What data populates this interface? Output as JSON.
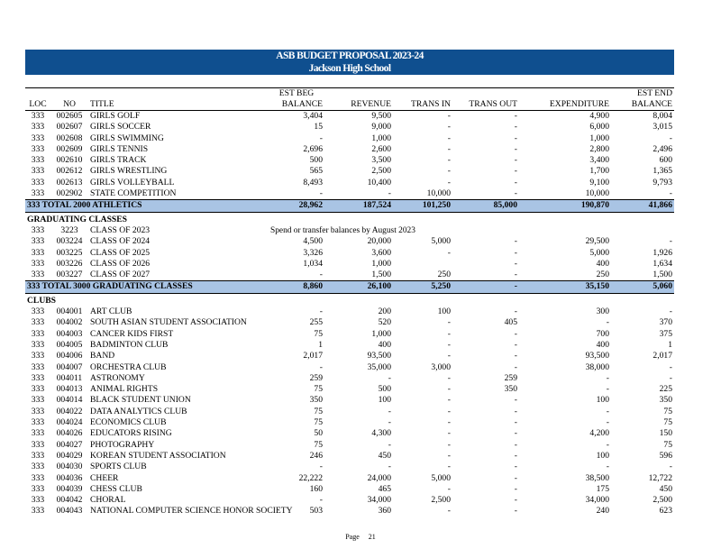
{
  "header": {
    "title": "ASB BUDGET PROPOSAL 2023-24",
    "school": "Jackson High School"
  },
  "columns": {
    "loc": "LOC",
    "no": "NO",
    "title": "TITLE",
    "est_beg_top": "EST BEG",
    "est_beg_bottom": "BALANCE",
    "revenue": "REVENUE",
    "trans_in": "TRANS IN",
    "trans_out": "TRANS OUT",
    "expenditure": "EXPENDITURE",
    "est_end_top": "EST END",
    "est_end_bottom": "BALANCE"
  },
  "athletics_rows": [
    {
      "loc": "333",
      "no": "002605",
      "title": "GIRLS GOLF",
      "beg": "3,404",
      "rev": "9,500",
      "tin": "-",
      "tout": "-",
      "exp": "4,900",
      "end": "8,004"
    },
    {
      "loc": "333",
      "no": "002607",
      "title": "GIRLS SOCCER",
      "beg": "15",
      "rev": "9,000",
      "tin": "-",
      "tout": "-",
      "exp": "6,000",
      "end": "3,015"
    },
    {
      "loc": "333",
      "no": "002608",
      "title": "GIRLS SWIMMING",
      "beg": "-",
      "rev": "1,000",
      "tin": "-",
      "tout": "-",
      "exp": "1,000",
      "end": "-"
    },
    {
      "loc": "333",
      "no": "002609",
      "title": "GIRLS TENNIS",
      "beg": "2,696",
      "rev": "2,600",
      "tin": "-",
      "tout": "-",
      "exp": "2,800",
      "end": "2,496"
    },
    {
      "loc": "333",
      "no": "002610",
      "title": "GIRLS TRACK",
      "beg": "500",
      "rev": "3,500",
      "tin": "-",
      "tout": "-",
      "exp": "3,400",
      "end": "600"
    },
    {
      "loc": "333",
      "no": "002612",
      "title": "GIRLS WRESTLING",
      "beg": "565",
      "rev": "2,500",
      "tin": "-",
      "tout": "-",
      "exp": "1,700",
      "end": "1,365"
    },
    {
      "loc": "333",
      "no": "002613",
      "title": "GIRLS VOLLEYBALL",
      "beg": "8,493",
      "rev": "10,400",
      "tin": "-",
      "tout": "-",
      "exp": "9,100",
      "end": "9,793"
    },
    {
      "loc": "333",
      "no": "002902",
      "title": "STATE COMPETITION",
      "beg": "-",
      "rev": "-",
      "tin": "10,000",
      "tout": "-",
      "exp": "10,000",
      "end": "-"
    }
  ],
  "athletics_total": {
    "label": "333  TOTAL 2000 ATHLETICS",
    "beg": "28,962",
    "rev": "187,524",
    "tin": "101,250",
    "tout": "85,000",
    "exp": "190,870",
    "end": "41,866"
  },
  "graduating": {
    "heading": "GRADUATING CLASSES",
    "note_row": {
      "loc": "333",
      "no": "3223",
      "title": "CLASS OF 2023",
      "note": "Spend or transfer  balances  by August 2023"
    },
    "rows": [
      {
        "loc": "333",
        "no": "003224",
        "title": "CLASS OF 2024",
        "beg": "4,500",
        "rev": "20,000",
        "tin": "5,000",
        "tout": "-",
        "exp": "29,500",
        "end": "-"
      },
      {
        "loc": "333",
        "no": "003225",
        "title": "CLASS OF 2025",
        "beg": "3,326",
        "rev": "3,600",
        "tin": "-",
        "tout": "-",
        "exp": "5,000",
        "end": "1,926"
      },
      {
        "loc": "333",
        "no": "003226",
        "title": "CLASS OF 2026",
        "beg": "1,034",
        "rev": "1,000",
        "tin": "",
        "tout": "-",
        "exp": "400",
        "end": "1,634"
      },
      {
        "loc": "333",
        "no": "003227",
        "title": "CLASS OF 2027",
        "beg": "-",
        "rev": "1,500",
        "tin": "250",
        "tout": "-",
        "exp": "250",
        "end": "1,500"
      }
    ],
    "total": {
      "label": "333  TOTAL 3000 GRADUATING CLASSES",
      "beg": "8,860",
      "rev": "26,100",
      "tin": "5,250",
      "tout": "-",
      "exp": "35,150",
      "end": "5,060"
    }
  },
  "clubs": {
    "heading": "CLUBS",
    "rows": [
      {
        "loc": "333",
        "no": "004001",
        "title": "ART CLUB",
        "beg": "-",
        "rev": "200",
        "tin": "100",
        "tout": "-",
        "exp": "300",
        "end": "-"
      },
      {
        "loc": "333",
        "no": "004002",
        "title": "SOUTH ASIAN STUDENT ASSOCIATION",
        "beg": "255",
        "rev": "520",
        "tin": "-",
        "tout": "405",
        "exp": "-",
        "end": "370"
      },
      {
        "loc": "333",
        "no": "004003",
        "title": "CANCER KIDS FIRST",
        "beg": "75",
        "rev": "1,000",
        "tin": "-",
        "tout": "-",
        "exp": "700",
        "end": "375"
      },
      {
        "loc": "333",
        "no": "004005",
        "title": "BADMINTON CLUB",
        "beg": "1",
        "rev": "400",
        "tin": "-",
        "tout": "-",
        "exp": "400",
        "end": "1"
      },
      {
        "loc": "333",
        "no": "004006",
        "title": "BAND",
        "beg": "2,017",
        "rev": "93,500",
        "tin": "-",
        "tout": "-",
        "exp": "93,500",
        "end": "2,017"
      },
      {
        "loc": "333",
        "no": "004007",
        "title": "ORCHESTRA CLUB",
        "beg": "-",
        "rev": "35,000",
        "tin": "3,000",
        "tout": "-",
        "exp": "38,000",
        "end": "-"
      },
      {
        "loc": "333",
        "no": "004011",
        "title": "ASTRONOMY",
        "beg": "259",
        "rev": "-",
        "tin": "-",
        "tout": "259",
        "exp": "-",
        "end": "-"
      },
      {
        "loc": "333",
        "no": "004013",
        "title": "ANIMAL RIGHTS",
        "beg": "75",
        "rev": "500",
        "tin": "-",
        "tout": "350",
        "exp": "-",
        "end": "225"
      },
      {
        "loc": "333",
        "no": "004014",
        "title": "BLACK STUDENT UNION",
        "beg": "350",
        "rev": "100",
        "tin": "-",
        "tout": "-",
        "exp": "100",
        "end": "350"
      },
      {
        "loc": "333",
        "no": "004022",
        "title": "DATA ANALYTICS CLUB",
        "beg": "75",
        "rev": "-",
        "tin": "-",
        "tout": "-",
        "exp": "-",
        "end": "75"
      },
      {
        "loc": "333",
        "no": "004024",
        "title": "ECONOMICS CLUB",
        "beg": "75",
        "rev": "-",
        "tin": "-",
        "tout": "-",
        "exp": "-",
        "end": "75"
      },
      {
        "loc": "333",
        "no": "004026",
        "title": "EDUCATORS RISING",
        "beg": "50",
        "rev": "4,300",
        "tin": "-",
        "tout": "-",
        "exp": "4,200",
        "end": "150"
      },
      {
        "loc": "333",
        "no": "004027",
        "title": "PHOTOGRAPHY",
        "beg": "75",
        "rev": "-",
        "tin": "-",
        "tout": "-",
        "exp": "-",
        "end": "75"
      },
      {
        "loc": "333",
        "no": "004029",
        "title": "KOREAN STUDENT ASSOCIATION",
        "beg": "246",
        "rev": "450",
        "tin": "-",
        "tout": "-",
        "exp": "100",
        "end": "596"
      },
      {
        "loc": "333",
        "no": "004030",
        "title": "SPORTS CLUB",
        "beg": "-",
        "rev": "-",
        "tin": "-",
        "tout": "-",
        "exp": "-",
        "end": "-"
      },
      {
        "loc": "333",
        "no": "004036",
        "title": "CHEER",
        "beg": "22,222",
        "rev": "24,000",
        "tin": "5,000",
        "tout": "-",
        "exp": "38,500",
        "end": "12,722"
      },
      {
        "loc": "333",
        "no": "004039",
        "title": "CHESS CLUB",
        "beg": "160",
        "rev": "465",
        "tin": "-",
        "tout": "-",
        "exp": "175",
        "end": "450"
      },
      {
        "loc": "333",
        "no": "004042",
        "title": "CHORAL",
        "beg": "-",
        "rev": "34,000",
        "tin": "2,500",
        "tout": "-",
        "exp": "34,000",
        "end": "2,500"
      },
      {
        "loc": "333",
        "no": "004043",
        "title": "NATIONAL COMPUTER SCIENCE HONOR SOCIETY",
        "beg": "503",
        "rev": "360",
        "tin": "-",
        "tout": "-",
        "exp": "240",
        "end": "623"
      }
    ]
  },
  "footer": {
    "page_label": "Page",
    "page_number": "21"
  }
}
